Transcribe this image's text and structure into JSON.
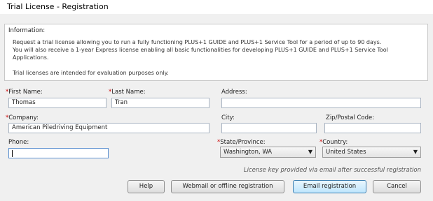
{
  "window": {
    "title": "Trial License - Registration"
  },
  "info": {
    "heading": "Information:",
    "lines": [
      "Request a trial license allowing you to run a fully functioning PLUS+1 GUIDE and PLUS+1 Service Tool for a period of up to 90 days.",
      "You will also receive a 1-year Express license enabling all basic functionalities for developing PLUS+1 GUIDE and PLUS+1 Service Tool",
      "Applications.",
      "Trial licenses are intended for evaluation purposes only."
    ]
  },
  "form": {
    "required_marker": "*",
    "first_name": {
      "label": "First Name:",
      "value": "Thomas",
      "required": true
    },
    "last_name": {
      "label": "Last Name:",
      "value": "Tran",
      "required": true
    },
    "address": {
      "label": "Address:",
      "value": ""
    },
    "company": {
      "label": "Company:",
      "value": "American Piledriving Equipment",
      "required": true
    },
    "city": {
      "label": "City:",
      "value": ""
    },
    "zip": {
      "label": "Zip/Postal Code:",
      "value": ""
    },
    "phone": {
      "label": "Phone:",
      "value": ""
    },
    "state": {
      "label": "State/Province:",
      "value": "Washington, WA",
      "required": true
    },
    "country": {
      "label": "Country:",
      "value": "United States",
      "required": true
    }
  },
  "hint": "License key provided via email after successful registration",
  "buttons": {
    "help": "Help",
    "webmail": "Webmail or offline registration",
    "email": "Email registration",
    "cancel": "Cancel"
  },
  "colors": {
    "required": "#cc0000",
    "default_button_border": "#3c7fb1"
  },
  "icons": {
    "dropdown": "chevron-down-icon"
  }
}
